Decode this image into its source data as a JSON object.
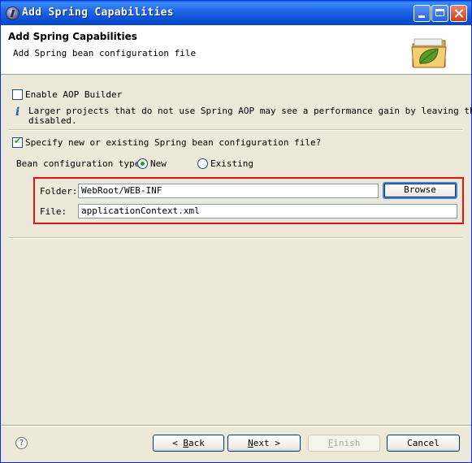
{
  "window": {
    "title": "Add Spring Capabilities"
  },
  "banner": {
    "title": "Add Spring Capabilities",
    "description": "Add Spring bean configuration file"
  },
  "aop": {
    "label": "Enable AOP Builder",
    "checked": false,
    "info_line1": "Larger projects that do not use Spring AOP may see a performance gain by leaving this",
    "info_line2": "disabled."
  },
  "specify": {
    "label": "Specify new or existing Spring bean configuration file?",
    "checked": true
  },
  "bean_type": {
    "label": "Bean configuration type:",
    "options": [
      "New",
      "Existing"
    ],
    "selected": "New"
  },
  "folder": {
    "label": "Folder:",
    "value": "WebRoot/WEB-INF",
    "browse_label": "Browse"
  },
  "file": {
    "label": "File:",
    "value": "applicationContext.xml"
  },
  "buttons": {
    "back_mnemonic": "B",
    "back_rest": "ack",
    "next_mnemonic": "N",
    "next_rest": "ext",
    "finish_mnemonic": "F",
    "finish_rest": "inish",
    "cancel": "Cancel",
    "help": "?"
  },
  "colors": {
    "highlight_border": "#e81010",
    "titlebar": "#0a4fd4"
  }
}
